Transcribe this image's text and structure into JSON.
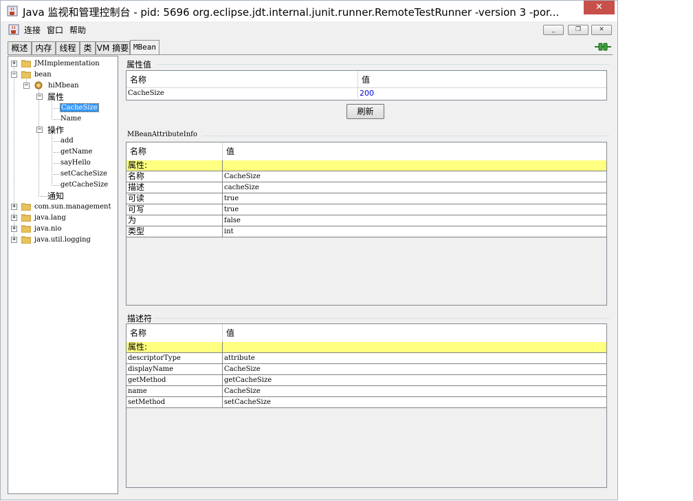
{
  "window": {
    "title": "Java 监视和管理控制台 - pid: 5696 org.eclipse.jdt.internal.junit.runner.RemoteTestRunner -version 3 -por...",
    "close_label": "✕"
  },
  "menu": {
    "items": [
      "连接",
      "窗口",
      "帮助"
    ]
  },
  "mdi": {
    "minimize": "_",
    "restore": "❐",
    "close": "✕"
  },
  "tabs": [
    "概述",
    "内存",
    "线程",
    "类",
    "VM 摘要",
    "MBean"
  ],
  "tree": {
    "nodes": [
      {
        "label": "JMImplementation"
      },
      {
        "label": "bean"
      },
      {
        "label": "hiMbean"
      },
      {
        "label": "属性"
      },
      {
        "label": "CacheSize"
      },
      {
        "label": "Name"
      },
      {
        "label": "操作"
      },
      {
        "label": "add"
      },
      {
        "label": "getName"
      },
      {
        "label": "sayHello"
      },
      {
        "label": "setCacheSize"
      },
      {
        "label": "getCacheSize"
      },
      {
        "label": "通知"
      },
      {
        "label": "com.sun.management"
      },
      {
        "label": "java.lang"
      },
      {
        "label": "java.nio"
      },
      {
        "label": "java.util.logging"
      }
    ]
  },
  "attr_values": {
    "title": "属性值",
    "headers": [
      "名称",
      "值"
    ],
    "rows": [
      [
        "CacheSize",
        "200"
      ]
    ],
    "refresh_label": "刷新"
  },
  "attr_info": {
    "title": "MBeanAttributeInfo",
    "headers": [
      "名称",
      "值"
    ],
    "rows": [
      [
        "属性:",
        ""
      ],
      [
        "名称",
        "CacheSize"
      ],
      [
        "描述",
        "cacheSize"
      ],
      [
        "可读",
        "true"
      ],
      [
        "可写",
        "true"
      ],
      [
        "为",
        "false"
      ],
      [
        "类型",
        "int"
      ]
    ]
  },
  "descriptor": {
    "title": "描述符",
    "headers": [
      "名称",
      "值"
    ],
    "rows": [
      [
        "属性:",
        ""
      ],
      [
        "descriptorType",
        "attribute"
      ],
      [
        "displayName",
        "CacheSize"
      ],
      [
        "getMethod",
        "getCacheSize"
      ],
      [
        "name",
        "CacheSize"
      ],
      [
        "setMethod",
        "setCacheSize"
      ]
    ]
  },
  "colors": {
    "highlight_row": "#ffff80",
    "selection": "#3399ff",
    "close_button": "#c7504b",
    "value_blue": "#0000cc"
  }
}
